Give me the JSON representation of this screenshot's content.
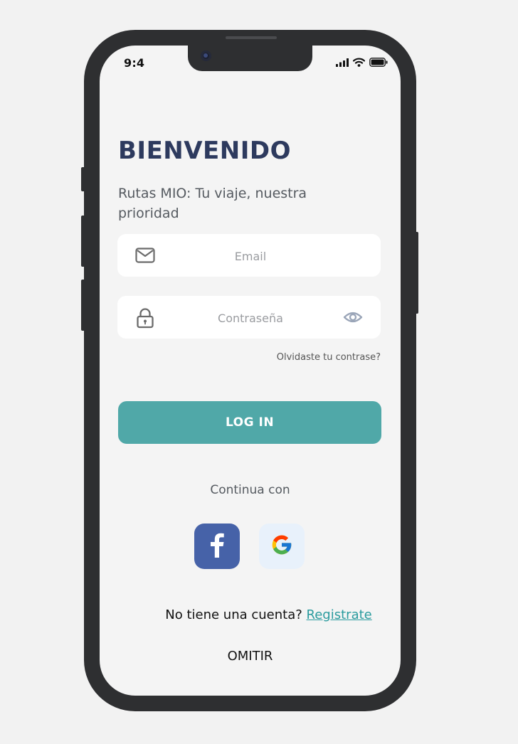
{
  "status_bar": {
    "time": "9:4"
  },
  "welcome": {
    "title": "BIENVENIDO",
    "subtitle": "Rutas MIO: Tu viaje, nuestra prioridad"
  },
  "form": {
    "email_placeholder": "Email",
    "password_placeholder": "Contraseña",
    "forgot_link": "Olvidaste tu contrase?",
    "login_label": "LOG IN"
  },
  "social": {
    "continue_label": "Continua con",
    "providers": [
      "facebook-icon",
      "google-icon"
    ]
  },
  "footer": {
    "no_account_text": "No tiene una cuenta?",
    "register_link": "Registrate",
    "skip_label": "OMITIR"
  },
  "colors": {
    "title": "#2d3a5e",
    "primary_button": "#50a8a8",
    "link": "#2a9b9e",
    "facebook": "#4662a8",
    "phone_frame": "#2e2f31"
  }
}
